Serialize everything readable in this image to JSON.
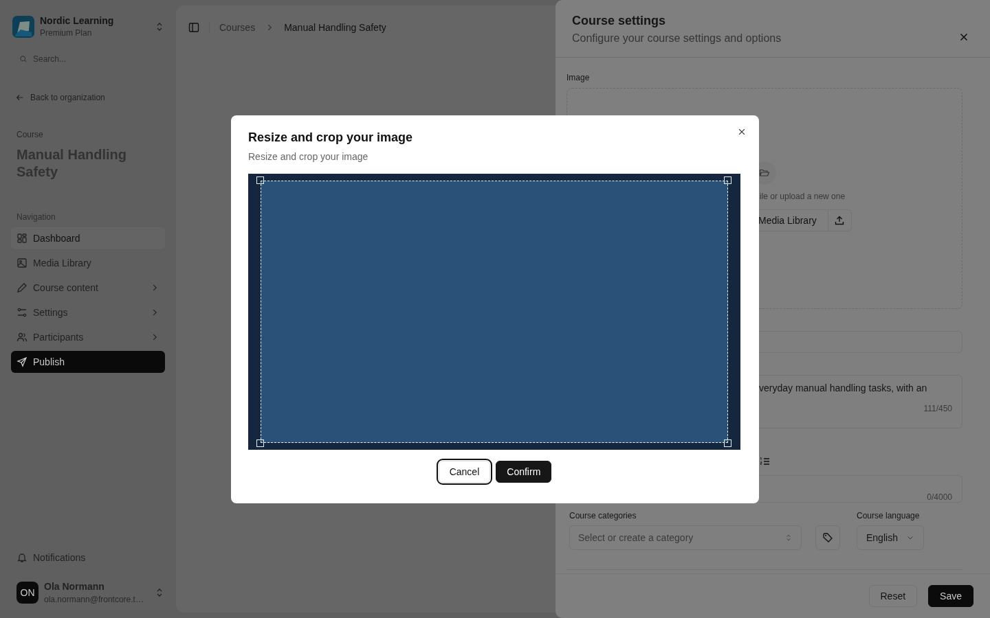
{
  "sidebar": {
    "org": {
      "name": "Nordic Learning",
      "plan": "Premium Plan"
    },
    "search": {
      "placeholder": "Search..."
    },
    "back_link": "Back to organization",
    "course_label": "Course",
    "course_title": "Manual Handling Safety",
    "nav_heading": "Navigation",
    "nav_items": [
      {
        "label": "Dashboard",
        "selected": false,
        "hovered": true,
        "has_submenu": false
      },
      {
        "label": "Media Library",
        "selected": false,
        "hovered": false,
        "has_submenu": false
      },
      {
        "label": "Course content",
        "selected": false,
        "hovered": false,
        "has_submenu": true
      },
      {
        "label": "Settings",
        "selected": false,
        "hovered": false,
        "has_submenu": true
      },
      {
        "label": "Participants",
        "selected": false,
        "hovered": false,
        "has_submenu": true
      },
      {
        "label": "Publish",
        "selected": true,
        "hovered": false,
        "has_submenu": false
      }
    ],
    "notifications": "Notifications",
    "user": {
      "initials": "ON",
      "name": "Ola Normann",
      "email": "ola.normann@frontcore.t…"
    }
  },
  "breadcrumb": [
    "Courses",
    "Manual Handling Safety"
  ],
  "settings_panel": {
    "title": "Course settings",
    "subtitle": "Configure your course settings and options",
    "image_label": "Image",
    "upload_hint": "ile or upload a new one",
    "media_button": "Media Library",
    "description_excerpt": "veryday manual handling tasks, with an",
    "description_count": "111/450",
    "content_count": "0/4000",
    "categories": {
      "label": "Course categories",
      "placeholder": "Select or create a category"
    },
    "language": {
      "label": "Course language",
      "value": "English"
    },
    "buttons": [
      {
        "label": "Reset",
        "kind": "secondary"
      },
      {
        "label": "Save",
        "kind": "primary"
      }
    ]
  },
  "dialog": {
    "title": "Resize and crop your image",
    "subtitle": "Resize and crop your image",
    "buttons": [
      {
        "label": "Cancel",
        "kind": "secondary",
        "focused": true
      },
      {
        "label": "Confirm",
        "kind": "primary",
        "focused": false
      }
    ]
  }
}
